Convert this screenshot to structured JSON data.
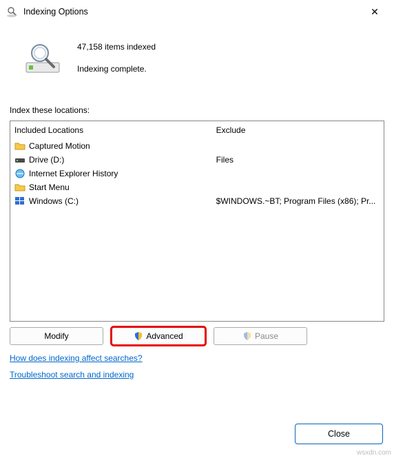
{
  "window": {
    "title": "Indexing Options",
    "close_glyph": "✕"
  },
  "status": {
    "count_text": "47,158 items indexed",
    "state_text": "Indexing complete."
  },
  "section_label": "Index these locations:",
  "columns": {
    "included": "Included Locations",
    "exclude": "Exclude"
  },
  "rows": [
    {
      "icon": "folder",
      "name": "Captured Motion",
      "exclude": ""
    },
    {
      "icon": "drive",
      "name": "Drive (D:)",
      "exclude": "Files"
    },
    {
      "icon": "ie",
      "name": "Internet Explorer History",
      "exclude": ""
    },
    {
      "icon": "folder",
      "name": "Start Menu",
      "exclude": ""
    },
    {
      "icon": "windows",
      "name": "Windows (C:)",
      "exclude": "$WINDOWS.~BT; Program Files (x86); Pr..."
    }
  ],
  "buttons": {
    "modify": "Modify",
    "advanced": "Advanced",
    "pause": "Pause",
    "close": "Close"
  },
  "links": {
    "how": "How does indexing affect searches?",
    "troubleshoot": "Troubleshoot search and indexing"
  },
  "watermark": "wsxdn.com"
}
